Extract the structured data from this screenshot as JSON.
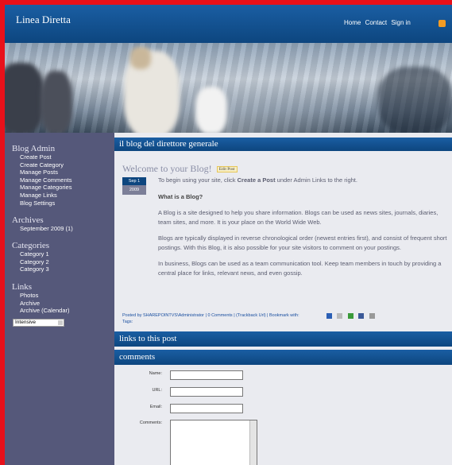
{
  "header": {
    "site_title": "Linea Diretta",
    "nav": [
      "Home",
      "Contact",
      "Sign in"
    ]
  },
  "sidebar": {
    "blog_admin": {
      "title": "Blog Admin",
      "items": [
        "Create Post",
        "Create Category",
        "Manage Posts",
        "Manage Comments",
        "Manage Categories",
        "Manage Links",
        "Blog Settings"
      ]
    },
    "archives": {
      "title": "Archives",
      "items": [
        "September 2009 (1)"
      ]
    },
    "categories": {
      "title": "Categories",
      "items": [
        "Category 1",
        "Category 2",
        "Category 3"
      ]
    },
    "links": {
      "title": "Links",
      "items": [
        "Photos",
        "Archive",
        "Archive (Calendar)"
      ]
    },
    "view_select": "Intensive"
  },
  "main": {
    "blog_title": "il blog del direttore generale",
    "post": {
      "title": "Welcome to your Blog!",
      "edit_label": "Edit Post",
      "date_month": "Sep 1",
      "date_year": "2009",
      "intro_before": "To begin using your site, click ",
      "intro_link": "Create a Post",
      "intro_after": " under Admin Links to the right.",
      "what_heading": "What is a Blog?",
      "paragraphs": [
        "A Blog is a site designed to help you share information. Blogs can be used as news sites, journals, diaries, team sites, and more. It is your place on the World Wide Web.",
        "Blogs are typically displayed in reverse chronological order (newest entries first), and consist of frequent short postings. With this Blog, it is also possible for your site visitors to comment on your postings.",
        "In business, Blogs can be used as a team communication tool. Keep team members in touch by providing a central place for links, relevant news, and even gossip."
      ],
      "footer_line1": "Posted by SHAREPOINTVS\\Administrator | 0 Comments | (Trackback Url) | Bookmark with:",
      "footer_line2": "Tags:"
    },
    "links_section_title": "links to this post",
    "comments_section_title": "comments",
    "form": {
      "name_label": "Name:",
      "url_label": "URL:",
      "email_label": "Email:",
      "comments_label": "Comments:"
    }
  },
  "colors": {
    "outer_border": "#e8101a",
    "header_blue": "#0d467f",
    "sidebar": "#55587a"
  }
}
